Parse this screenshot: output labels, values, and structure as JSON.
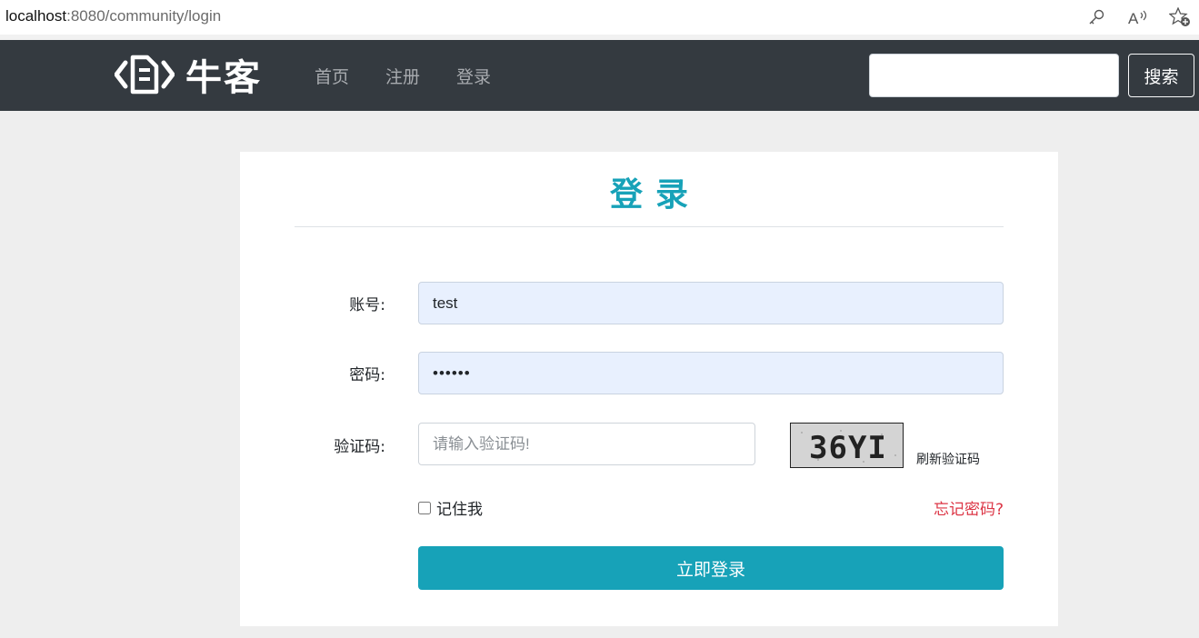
{
  "browser": {
    "url_host": "localhost",
    "url_rest": ":8080/community/login",
    "icons": [
      "key-icon",
      "read-aloud-icon",
      "favorite-add-icon"
    ]
  },
  "navbar": {
    "logo_text": "牛客",
    "links": [
      {
        "label": "首页"
      },
      {
        "label": "注册"
      },
      {
        "label": "登录"
      }
    ],
    "search_value": "",
    "search_button": "搜索"
  },
  "login": {
    "title": "登录",
    "username_label": "账号:",
    "username_value": "test",
    "password_label": "密码:",
    "password_value": "••••••",
    "captcha_label": "验证码:",
    "captcha_placeholder": "请输入验证码!",
    "captcha_text": "36YI",
    "refresh_label": "刷新验证码",
    "remember_label": "记住我",
    "forgot_label": "忘记密码?",
    "submit_label": "立即登录"
  },
  "colors": {
    "navbar_bg": "#343a40",
    "accent": "#17a2b8",
    "danger": "#dc3545",
    "page_bg": "#eeeeee"
  }
}
